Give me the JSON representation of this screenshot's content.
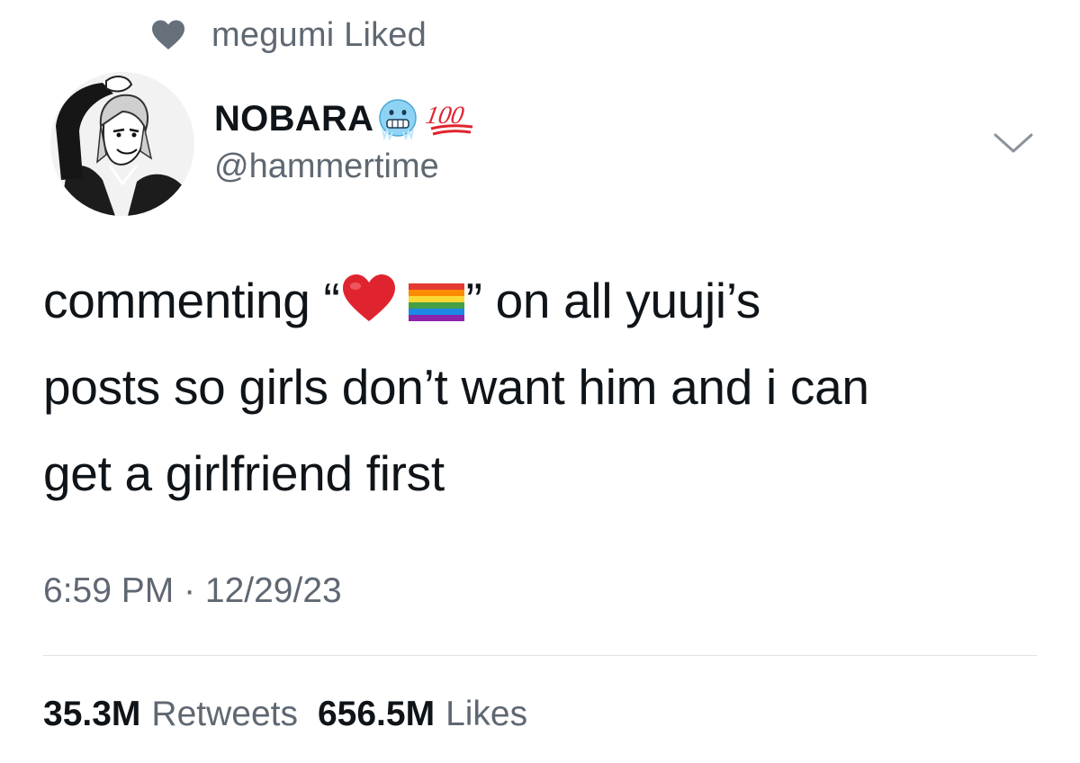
{
  "activity": {
    "icon": "heart-icon",
    "text": "megumi Liked"
  },
  "author": {
    "avatar": "anime-avatar",
    "display_name": "NOBARA",
    "name_emojis": [
      "freezing-face-emoji",
      "hundred-points-emoji"
    ],
    "handle": "@hammertime"
  },
  "menu": {
    "icon": "chevron-down-icon"
  },
  "tweet": {
    "line1_before": "commenting “",
    "line1_emojis": [
      "red-heart-emoji",
      "rainbow-flag-emoji"
    ],
    "line1_after": "” on all yuuji’s",
    "line2": "posts so girls don’t want him and i can",
    "line3": "get a girlfriend first"
  },
  "timestamp": "6:59 PM · 12/29/23",
  "stats": {
    "retweets_count": "35.3M",
    "retweets_label": "Retweets",
    "likes_count": "656.5M",
    "likes_label": "Likes"
  },
  "colors": {
    "text_primary": "#0f1419",
    "text_secondary": "#5f6872",
    "divider": "#dde2e6",
    "heart_gray": "#66707a",
    "emoji_red": "#e0242f"
  }
}
